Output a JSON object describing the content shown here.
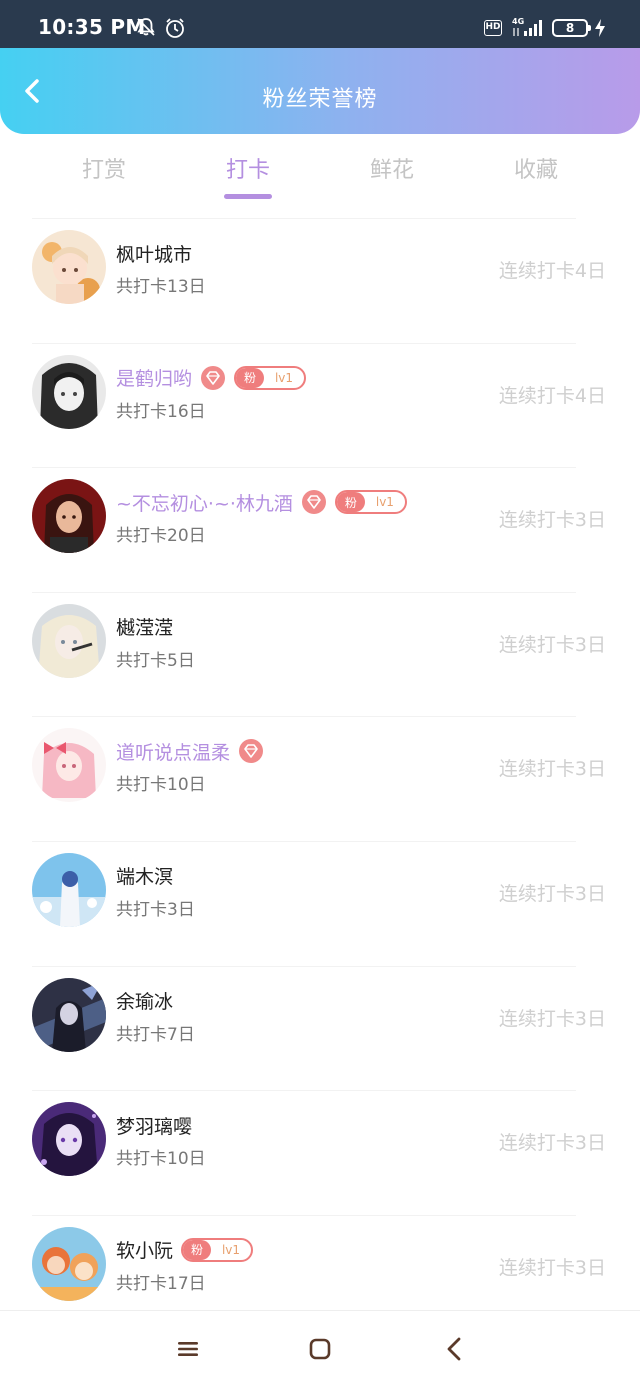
{
  "status_bar": {
    "time": "10:35 PM",
    "network": "4G",
    "hd": "HD",
    "battery": "8"
  },
  "header": {
    "title": "粉丝荣誉榜",
    "gradient_start": "#45d0f2",
    "gradient_end": "#b89be9"
  },
  "tabs": [
    {
      "label": "打赏",
      "active": false
    },
    {
      "label": "打卡",
      "active": true
    },
    {
      "label": "鲜花",
      "active": false
    },
    {
      "label": "收藏",
      "active": false
    }
  ],
  "accent_color": "#b48fe0",
  "badge_color": "#ef7d7d",
  "fans": [
    {
      "name": "枫叶城市",
      "vip": false,
      "gem": false,
      "fan_badge": false,
      "total": "共打卡13日",
      "streak": "连续打卡4日",
      "avatar_icon": "avatar-autumn-girl"
    },
    {
      "name": "是鹤归哟",
      "vip": true,
      "gem": true,
      "fan_badge": true,
      "badge_label": "粉",
      "badge_level": "lv1",
      "total": "共打卡16日",
      "streak": "连续打卡4日",
      "avatar_icon": "avatar-monochrome-girl"
    },
    {
      "name": "~不忘初心·~·林九酒",
      "vip": true,
      "gem": true,
      "fan_badge": true,
      "badge_label": "粉",
      "badge_level": "lv1",
      "total": "共打卡20日",
      "streak": "连续打卡3日",
      "avatar_icon": "avatar-red-girl"
    },
    {
      "name": "樾滢滢",
      "vip": false,
      "gem": false,
      "fan_badge": false,
      "total": "共打卡5日",
      "streak": "连续打卡3日",
      "avatar_icon": "avatar-blonde-girl"
    },
    {
      "name": "道听说点温柔",
      "vip": true,
      "gem": true,
      "fan_badge": false,
      "total": "共打卡10日",
      "streak": "连续打卡3日",
      "avatar_icon": "avatar-pink-hair-girl"
    },
    {
      "name": "端木溟",
      "vip": false,
      "gem": false,
      "fan_badge": false,
      "total": "共打卡3日",
      "streak": "连续打卡3日",
      "avatar_icon": "avatar-blue-sky"
    },
    {
      "name": "余瑜冰",
      "vip": false,
      "gem": false,
      "fan_badge": false,
      "total": "共打卡7日",
      "streak": "连续打卡3日",
      "avatar_icon": "avatar-dark-warrior"
    },
    {
      "name": "梦羽璃嘤",
      "vip": false,
      "gem": false,
      "fan_badge": false,
      "total": "共打卡10日",
      "streak": "连续打卡3日",
      "avatar_icon": "avatar-purple-girl"
    },
    {
      "name": "软小阮",
      "vip": false,
      "gem": false,
      "fan_badge": true,
      "badge_label": "粉",
      "badge_level": "lv1",
      "total": "共打卡17日",
      "streak": "连续打卡3日",
      "avatar_icon": "avatar-cartoon-kids"
    }
  ]
}
